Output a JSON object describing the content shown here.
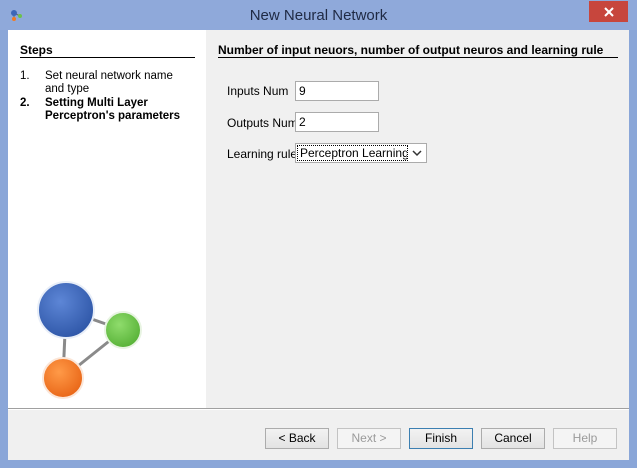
{
  "window": {
    "title": "New Neural Network"
  },
  "steps": {
    "heading": "Steps",
    "items": [
      {
        "number": "1.",
        "label": "Set neural network name and type",
        "active": false
      },
      {
        "number": "2.",
        "label": "Setting Multi Layer Perceptron's parameters",
        "active": true
      }
    ]
  },
  "main": {
    "heading": "Number of input neuors, number of output neuros and learning rule",
    "inputs_label": "Inputs Num",
    "inputs_value": "9",
    "outputs_label": "Outputs Num",
    "outputs_value": "2",
    "learning_rule_label": "Learning rule",
    "learning_rule_value": "Perceptron Learning"
  },
  "buttons": {
    "back": "< Back",
    "next": "Next >",
    "finish": "Finish",
    "cancel": "Cancel",
    "help": "Help"
  },
  "colors": {
    "title_bar": "#8fa9da",
    "close_button": "#c7463d",
    "logo_blue": "#3c66b8",
    "logo_green": "#6cc24a",
    "logo_orange": "#f07a24"
  }
}
